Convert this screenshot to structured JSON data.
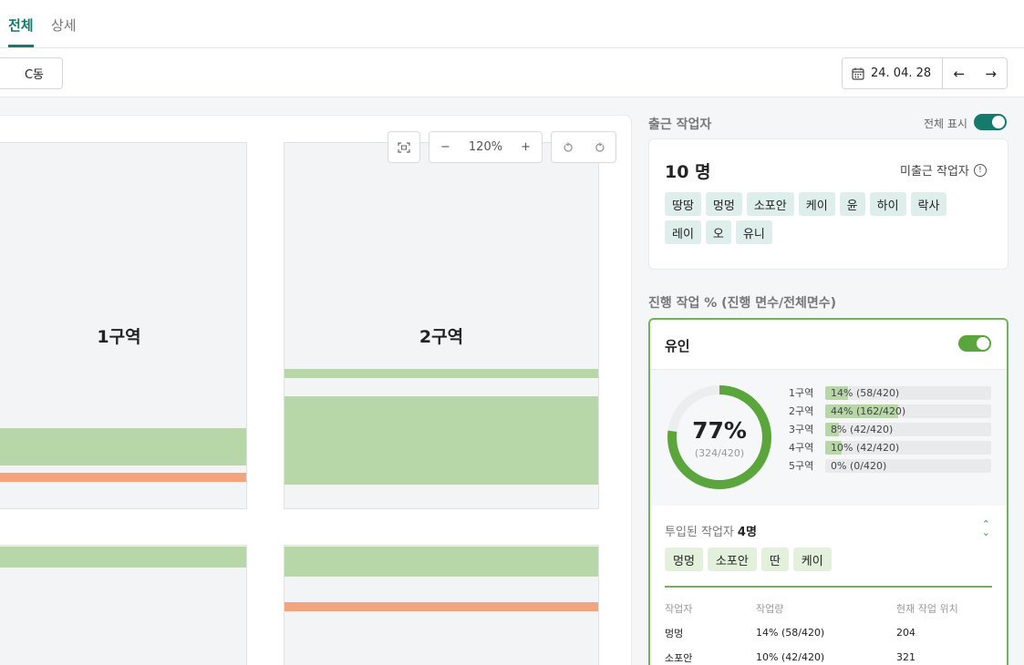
{
  "tabs": {
    "all": "전체",
    "detail": "상세"
  },
  "toolbar": {
    "building_button": "C동",
    "date": "24. 04. 28",
    "prev": "←",
    "next": "→"
  },
  "map": {
    "zone1_label": "1구역",
    "zone2_label": "2구역",
    "zoom": "120%",
    "zoom_out": "−",
    "zoom_in": "+"
  },
  "workers": {
    "title": "출근 작업자",
    "show_all": "전체 표시",
    "count": "10 명",
    "missing_label": "미출근 작업자",
    "names": [
      "땅땅",
      "멍멍",
      "소포안",
      "케이",
      "윤",
      "하이",
      "락사",
      "레이",
      "오",
      "유니"
    ]
  },
  "progress": {
    "title": "진행 작업 % (진행 면수/전체면수)",
    "card_title": "유인",
    "percent": "77%",
    "fraction": "(324/420)",
    "percent_value": 0.77,
    "zones": [
      {
        "label": "1구역",
        "text": "14% (58/420)",
        "fraction": 0.14
      },
      {
        "label": "2구역",
        "text": "44% (162/420)",
        "fraction": 0.44
      },
      {
        "label": "3구역",
        "text": "8% (42/420)",
        "fraction": 0.08
      },
      {
        "label": "4구역",
        "text": "10% (42/420)",
        "fraction": 0.1
      },
      {
        "label": "5구역",
        "text": "0% (0/420)",
        "fraction": 0.0
      }
    ],
    "assigned_label": "투입된 작업자",
    "assigned_count": "4명",
    "assigned_names": [
      "멍멍",
      "소포안",
      "딴",
      "케이"
    ],
    "table": {
      "headers": [
        "작업자",
        "작업량",
        "현재 작업 위치"
      ],
      "rows": [
        [
          "멍멍",
          "14% (58/420)",
          "204"
        ],
        [
          "소포안",
          "10% (42/420)",
          "321"
        ]
      ]
    }
  },
  "colors": {
    "brand": "#137a6c",
    "green": "#5aa53c",
    "band_green": "#b7d7a8",
    "band_orange": "#f5a37a"
  }
}
